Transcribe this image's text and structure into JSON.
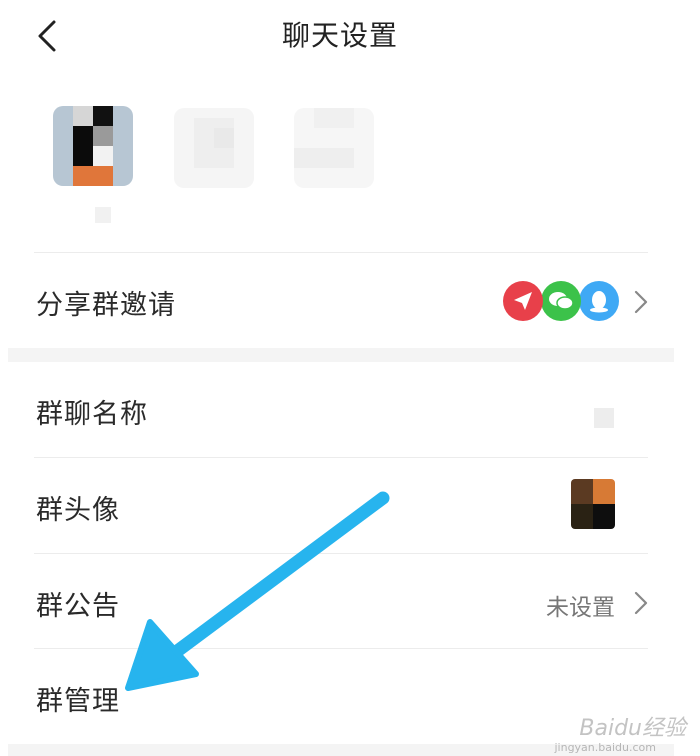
{
  "header": {
    "title": "聊天设置"
  },
  "members": [
    "member-avatar-1",
    "member-avatar-2",
    "member-avatar-3"
  ],
  "share": {
    "label": "分享群邀请",
    "icons": [
      "share-app-icon",
      "wechat-icon",
      "qq-icon"
    ]
  },
  "rows": {
    "group_name": {
      "label": "群聊名称"
    },
    "group_avatar": {
      "label": "群头像"
    },
    "group_notice": {
      "label": "群公告",
      "value": "未设置"
    },
    "group_manage": {
      "label": "群管理"
    }
  },
  "colors": {
    "share_red": "#e8404a",
    "wechat_green": "#3cc24a",
    "qq_blue": "#3fa9f5",
    "arrow_blue": "#27b4ee"
  },
  "watermark": {
    "text": "Baidu经验",
    "sub": "jingyan.baidu.com"
  }
}
